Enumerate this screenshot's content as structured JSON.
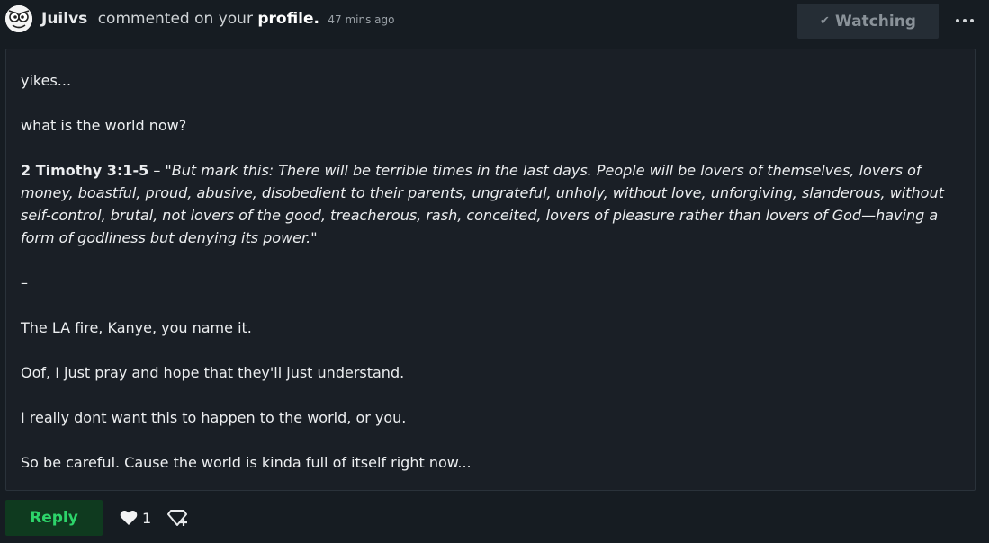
{
  "header": {
    "username": "Juilvs",
    "action": "commented on your",
    "target": "profile.",
    "time": "47 mins ago"
  },
  "watch_button": {
    "label": "Watching",
    "icon": "check-icon"
  },
  "more_button": {
    "icon": "more-dots-icon"
  },
  "comment": {
    "line1": "yikes...",
    "line2": "what is the world now?",
    "verse_ref": "2 Timothy 3:1-5",
    "verse_sep": " – ",
    "verse_text": "\"But mark this: There will be terrible times in the last days. People will be lovers of themselves, lovers of money, boastful, proud, abusive, disobedient to their parents, ungrateful, unholy, without love, unforgiving, slanderous, without self-control, brutal, not lovers of the good, treacherous, rash, conceited, lovers of pleasure rather than lovers of God—having a form of godliness but denying its power.\"",
    "separator": "–",
    "line3": "The LA fire, Kanye, you name it.",
    "line4": "Oof, I just pray and hope that they'll just understand.",
    "line5": "I really dont want this to happen to the world, or you.",
    "line6": "So be careful. Cause the world is kinda full of itself right now..."
  },
  "footer": {
    "reply_label": "Reply",
    "favourite_count": "1",
    "favourite_icon": "heart-icon",
    "gift_icon": "gift-icon"
  },
  "colors": {
    "background": "#161c22",
    "comment_bg": "#1a1f26",
    "reply_bg": "#0f3a1f",
    "reply_text": "#2dd46a",
    "watch_bg": "#252d35"
  }
}
